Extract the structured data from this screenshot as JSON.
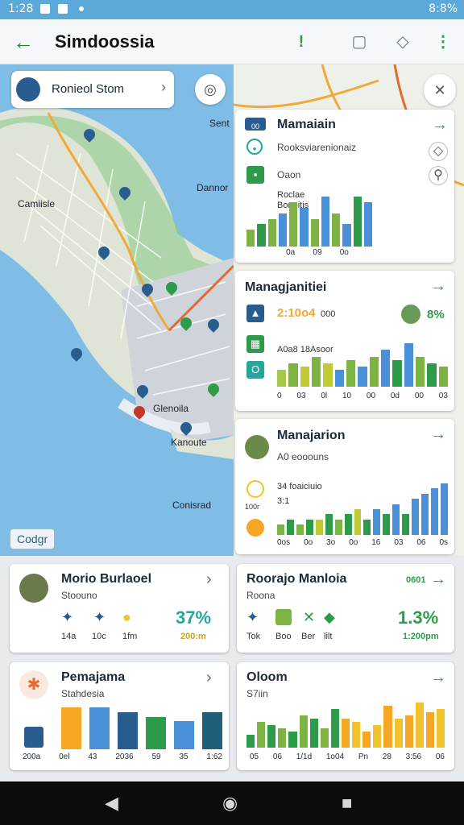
{
  "status": {
    "time": "1:28",
    "battery": "8:8%"
  },
  "appbar": {
    "title": "Simdoossia",
    "back_icon": "arrow-left-icon",
    "actions": [
      "alert-icon",
      "square-icon",
      "tag-icon",
      "more-vertical-icon"
    ]
  },
  "map": {
    "search_chip": "Ronieol Stom",
    "label_camiisle": "Camiisle",
    "label_glenoila": "Glenoila",
    "label_kanoute": "Kanoute",
    "label_conisrad": "Conisrad",
    "label_sent": "Sent",
    "label_dannor": "Dannor",
    "codgr_badge": "Codgr"
  },
  "cards": {
    "c1": {
      "title": "Mamaiain",
      "row1": "Rooksviarenionaiz",
      "row2": "Oaon",
      "row3a": "Roclae",
      "row3b": "Bonoitis",
      "ticks": [
        "0a",
        "09",
        "0o"
      ],
      "badge": "00"
    },
    "c2": {
      "title": "Managjanitiei",
      "value": "2:10o4",
      "value_unit": "000",
      "percent": "8%",
      "sub": "A0a8 18Asoor",
      "ticks": [
        "0",
        "03",
        "0l",
        "10",
        "00",
        "0d",
        "00",
        "03"
      ]
    },
    "c3": {
      "title": "Manajarion",
      "sub": "A0 eooouns",
      "row1": "34 foaiciuio",
      "row2": "3:1",
      "row3": "100r",
      "ticks": [
        "0os",
        "0o",
        "3o",
        "0o",
        "16",
        "03",
        "06",
        "0s"
      ]
    },
    "b1": {
      "title": "Morio Burlaoel",
      "sub": "Stoouno",
      "labels": [
        "14a",
        "10c",
        "1fm"
      ],
      "percent": "37%",
      "footer": "200:m"
    },
    "b2": {
      "title": "Roorajo Manloia",
      "sub": "Roona",
      "badge": "0601",
      "labels": [
        "Tok",
        "Boo",
        "Ber",
        "lilt"
      ],
      "percent": "1.3%",
      "footer": "1:200pm"
    },
    "b3": {
      "title": "Pemajama",
      "sub": "Stahdesia",
      "footer": [
        "200a",
        "0el",
        "43",
        "2036",
        "59",
        "35",
        "1:62"
      ]
    },
    "b4": {
      "title": "Oloom",
      "sub": "S7iin",
      "footer": [
        "05",
        "06",
        "1/1d",
        "1o04",
        "Pn",
        "28",
        "3:56",
        "06"
      ]
    }
  },
  "chart_data": [
    {
      "type": "bar",
      "series": [
        {
          "values": [
            3,
            4,
            5,
            6,
            8,
            7,
            5,
            9,
            6,
            4,
            9,
            8
          ]
        }
      ]
    },
    {
      "type": "bar",
      "series": [
        {
          "values": [
            5,
            7,
            6,
            9,
            7,
            5,
            8,
            6,
            9,
            11,
            8,
            13,
            9,
            7,
            6
          ]
        }
      ]
    },
    {
      "type": "bar",
      "series": [
        {
          "values": [
            2,
            3,
            2,
            3,
            3,
            4,
            3,
            4,
            5,
            3,
            5,
            4,
            6,
            4,
            7,
            8,
            9,
            10
          ]
        }
      ]
    },
    {
      "type": "bar",
      "series": [
        {
          "values": [
            9,
            9,
            8,
            7,
            6,
            8
          ]
        }
      ]
    },
    {
      "type": "bar",
      "series": [
        {
          "values": [
            4,
            8,
            7,
            6,
            5,
            10,
            9,
            6,
            12,
            9,
            8,
            5,
            7,
            13,
            9,
            10,
            14,
            11,
            12
          ]
        }
      ]
    }
  ],
  "nav": {
    "back_icon": "back-triangle-icon",
    "home_icon": "home-circle-icon",
    "recents_icon": "recents-square-icon"
  }
}
